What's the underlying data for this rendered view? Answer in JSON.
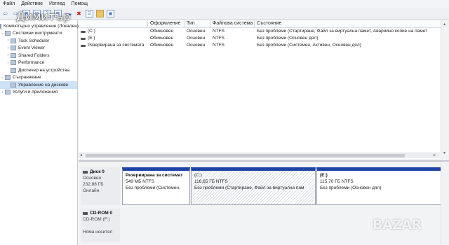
{
  "watermark": "Димитър",
  "logo": "BAZAR",
  "menu": [
    "Файл",
    "Действие",
    "Изглед",
    "Помощ"
  ],
  "toolbar_icons": [
    "back-icon",
    "forward-icon",
    "console-tree-icon",
    "properties-icon",
    "help-icon",
    "grid-icon",
    "connect-icon",
    "delete-icon",
    "checklist-icon",
    "folder-icon",
    "magnify-icon"
  ],
  "tree": [
    {
      "label": "Компютърно управление (Локален)",
      "tog": "",
      "depth": 0
    },
    {
      "label": "Системни инструменти",
      "tog": "⌄",
      "depth": 0
    },
    {
      "label": "Task Scheduler",
      "tog": "›",
      "depth": 1
    },
    {
      "label": "Event Viewer",
      "tog": "›",
      "depth": 1
    },
    {
      "label": "Shared Folders",
      "tog": "›",
      "depth": 1
    },
    {
      "label": "Performance",
      "tog": "›",
      "depth": 1
    },
    {
      "label": "Диспечер на устройства",
      "tog": "",
      "depth": 1
    },
    {
      "label": "Съхраняване",
      "tog": "⌄",
      "depth": 0
    },
    {
      "label": "Управление на дискове",
      "tog": "",
      "depth": 1,
      "selected": true
    },
    {
      "label": "Услуги и приложения",
      "tog": "›",
      "depth": 0
    }
  ],
  "grid": {
    "headers": [
      "",
      "Оформление",
      "Тип",
      "Файлова система",
      "Състояние"
    ],
    "rows": [
      {
        "volume": "(C:)",
        "layout": "Обикновен",
        "type": "Основен",
        "fs": "NTFS",
        "status": "Без проблеми (Стартиране, Файл за виртуална памет, Аварийно копие на памет"
      },
      {
        "volume": "(E:)",
        "layout": "Обикновен",
        "type": "Основен",
        "fs": "NTFS",
        "status": "Без проблеми (Основен дял)"
      },
      {
        "volume": "Резервирана за системата",
        "layout": "Обикновен",
        "type": "Основен",
        "fs": "NTFS",
        "status": "Без проблеми (Системен, Активен, Основен дял)"
      }
    ]
  },
  "disk0": {
    "title": "Диск 0",
    "type": "Основен",
    "size": "232,88 ГБ",
    "state": "Онлайн",
    "partitions": [
      {
        "name": "Резервирана за системат",
        "size": "549 МБ NTFS",
        "status": "Без проблеми (Системен,"
      },
      {
        "name": "(C:)",
        "size": "116,65 ГБ NTFS",
        "status": "Без проблеми (Стартиране, Файл за виртуална пам"
      },
      {
        "name": "(E:)",
        "size": "115,70 ГБ NTFS",
        "status": "Без проблеми (Основен дял)"
      }
    ]
  },
  "cdrom": {
    "title": "CD-ROM 0",
    "type": "CD-ROM (F:)",
    "state": "Няма носител"
  },
  "colors": {
    "partition_bar": "#1d43a7",
    "selection": "#cde1f7"
  }
}
